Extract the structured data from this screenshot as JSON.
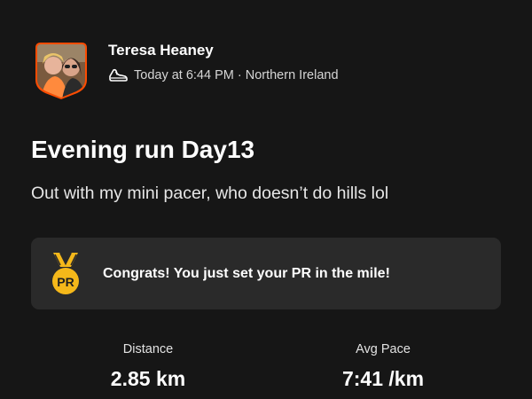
{
  "header": {
    "user_name": "Teresa Heaney",
    "activity_icon": "shoe-icon",
    "meta": "Today at 6:44 PM · Northern Ireland",
    "avatar": "avatar-photo",
    "avatar_border_color": "#fc4c02"
  },
  "activity": {
    "title": "Evening run Day13",
    "description": "Out with my mini pacer, who doesn’t do hills lol"
  },
  "achievement": {
    "icon": "pr-medal-icon",
    "badge_text": "PR",
    "text": "Congrats! You just set your PR in the mile!",
    "medal_color": "#f5b81a"
  },
  "stats": {
    "distance": {
      "label": "Distance",
      "value": "2.85 km"
    },
    "pace": {
      "label": "Avg Pace",
      "value": "7:41 /km"
    }
  },
  "colors": {
    "background": "#161616",
    "card": "#2a2a2a"
  }
}
